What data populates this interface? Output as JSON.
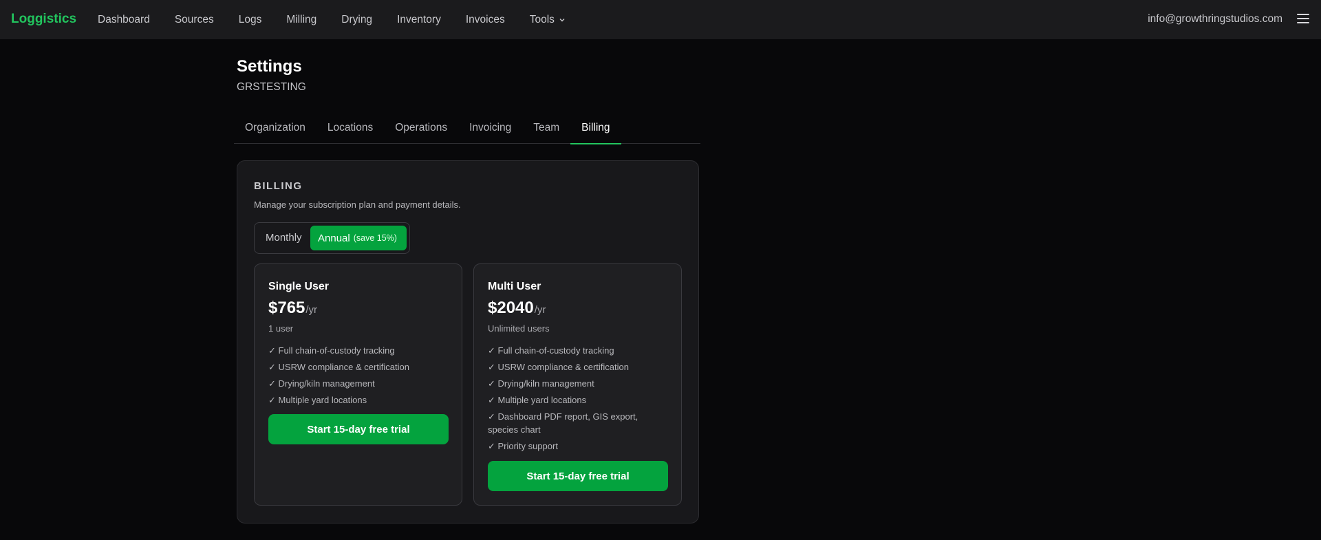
{
  "app": {
    "brand": "Loggistics",
    "nav": [
      {
        "label": "Dashboard"
      },
      {
        "label": "Sources"
      },
      {
        "label": "Logs"
      },
      {
        "label": "Milling"
      },
      {
        "label": "Drying"
      },
      {
        "label": "Inventory"
      },
      {
        "label": "Invoices"
      },
      {
        "label": "Tools",
        "dropdown": true
      }
    ],
    "user_email": "info@growthringstudios.com",
    "accent_color": "#22c55e"
  },
  "page": {
    "title": "Settings",
    "org_name": "GRSTESTING"
  },
  "tabs": [
    {
      "label": "Organization",
      "active": false
    },
    {
      "label": "Locations",
      "active": false
    },
    {
      "label": "Operations",
      "active": false
    },
    {
      "label": "Invoicing",
      "active": false
    },
    {
      "label": "Team",
      "active": false
    },
    {
      "label": "Billing",
      "active": true
    }
  ],
  "billing": {
    "heading": "BILLING",
    "description": "Manage your subscription plan and payment details.",
    "toggle": {
      "monthly_label": "Monthly",
      "annual_label": "Annual",
      "annual_note": "(save 15%)",
      "selected": "Annual"
    },
    "plans": [
      {
        "name": "Single User",
        "price": "$765",
        "period": "/yr",
        "users": "1 user",
        "features": [
          "✓ Full chain-of-custody tracking",
          "✓ USRW compliance & certification",
          "✓ Drying/kiln management",
          "✓ Multiple yard locations"
        ],
        "cta": "Start 15-day free trial"
      },
      {
        "name": "Multi User",
        "price": "$2040",
        "period": "/yr",
        "users": "Unlimited users",
        "features": [
          "✓ Full chain-of-custody tracking",
          "✓ USRW compliance & certification",
          "✓ Drying/kiln management",
          "✓ Multiple yard locations",
          "✓ Dashboard PDF report, GIS export, species chart",
          "✓ Priority support"
        ],
        "cta": "Start 15-day free trial"
      }
    ]
  }
}
